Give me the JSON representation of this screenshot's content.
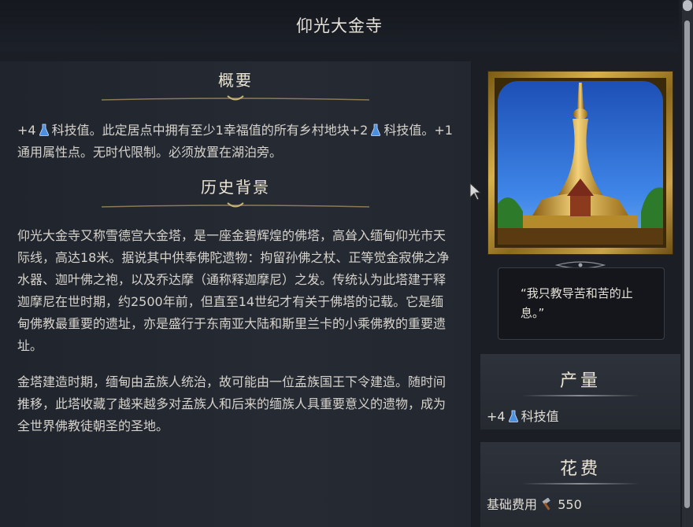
{
  "title": "仰光大金寺",
  "overview": {
    "heading": "概要",
    "parts": [
      "+4",
      "科技值。此定居点中拥有至少1幸福值的所有乡村地块+2",
      "科技值。+1通用属性点。无时代限制。必须放置在湖泊旁。"
    ]
  },
  "history": {
    "heading": "历史背景",
    "paragraph1": "仰光大金寺又称雪德宫大金塔，是一座金碧辉煌的佛塔，高耸入缅甸仰光市天际线，高达18米。据说其中供奉佛陀遗物：拘留孙佛之杖、正等觉金寂佛之净水器、迦叶佛之袍，以及乔达摩（通称释迦摩尼）之发。传统认为此塔建于释迦摩尼在世时期，约2500年前，但直至14世纪才有关于佛塔的记载。它是缅甸佛教最重要的遗址，亦是盛行于东南亚大陆和斯里兰卡的小乘佛教的重要遗址。",
    "paragraph2": "金塔建造时期，缅甸由孟族人统治，故可能由一位孟族国王下令建造。随时间推移，此塔收藏了越来越多对孟族人和后来的缅族人具重要意义的遗物，成为全世界佛教徒朝圣的圣地。"
  },
  "quote": "“我只教导苦和苦的止息。”",
  "yield": {
    "heading": "产量",
    "value": "+4",
    "label": "科技值"
  },
  "cost": {
    "heading": "花费",
    "label": "基础费用",
    "value": "550"
  },
  "icons": {
    "science": "flask-icon",
    "production": "hammer-icon"
  },
  "colors": {
    "science": "#4a8fe0",
    "gold": "#d8b04a"
  }
}
